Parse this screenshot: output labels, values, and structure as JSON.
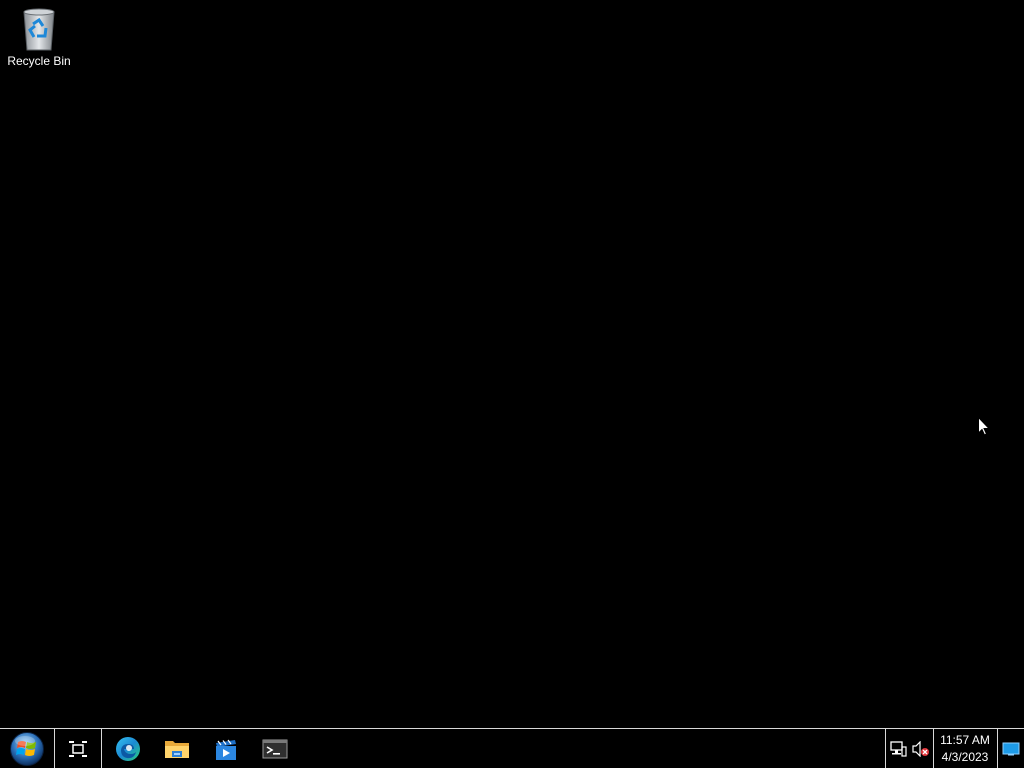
{
  "desktop": {
    "background_color": "#000000",
    "icons": [
      {
        "label": "Recycle Bin",
        "icon": "recycle-bin-icon"
      }
    ]
  },
  "taskbar": {
    "start_icon": "windows-start-orb-icon",
    "task_view_icon": "task-view-icon",
    "pinned": [
      {
        "name": "Microsoft Edge",
        "icon": "edge-icon"
      },
      {
        "name": "File Explorer",
        "icon": "folder-icon"
      },
      {
        "name": "Media Player",
        "icon": "media-player-icon"
      },
      {
        "name": "Terminal",
        "icon": "terminal-icon"
      }
    ],
    "tray": {
      "network_icon": "network-icon",
      "volume_icon": "volume-muted-icon"
    },
    "clock": {
      "time": "11:57 AM",
      "date": "4/3/2023"
    },
    "show_desktop_icon": "show-desktop-icon"
  }
}
